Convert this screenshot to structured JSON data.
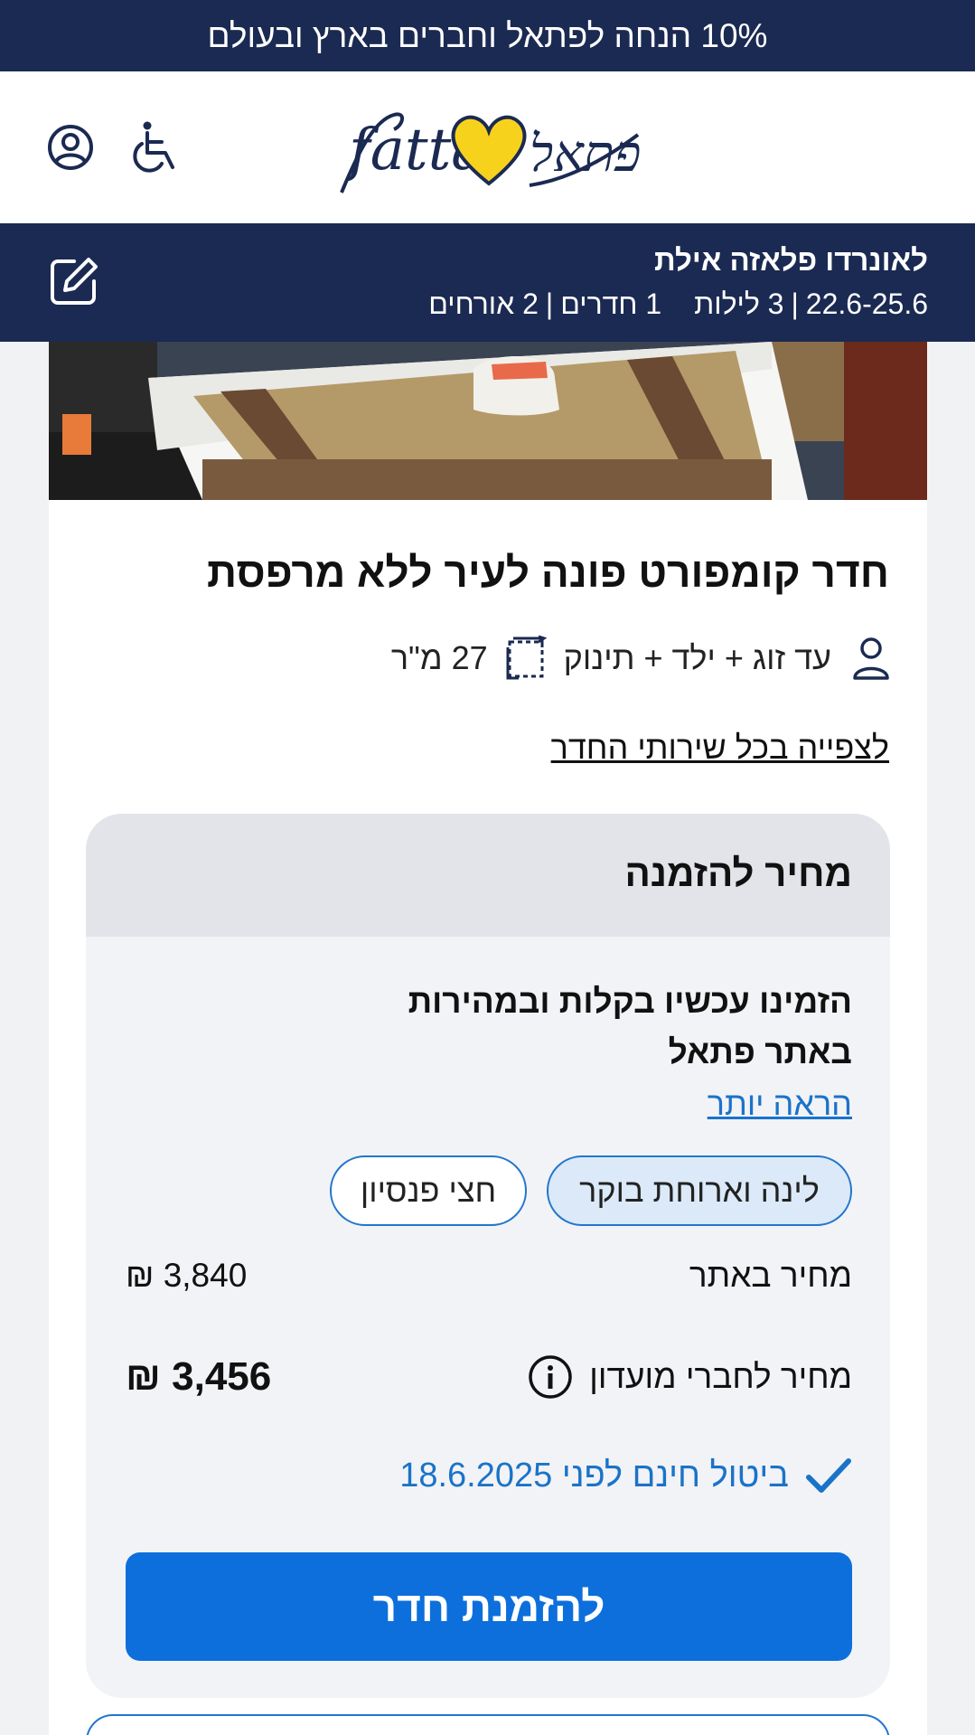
{
  "promo_bar": {
    "text": "10% הנחה לפתאל וחברים בארץ ובעולם"
  },
  "header": {
    "logo_text_latin": "fattal",
    "logo_text_hebrew": "פתאל",
    "icons": [
      "user-account-icon",
      "accessibility-icon"
    ]
  },
  "search_summary": {
    "hotel": "לאונרדו פלאזה אילת",
    "dates": "22.6-25.6",
    "nights": "3 לילות",
    "rooms": "1 חדרים",
    "guests": "2 אורחים",
    "separator": "|",
    "edit_icon": "edit-pencil-icon"
  },
  "room": {
    "title": "חדר קומפורט פונה לעיר ללא מרפסת",
    "occupancy": "עד זוג + ילד + תינוק",
    "size": "27 מ\"ר",
    "services_link": "לצפייה בכל שירותי החדר"
  },
  "price_box": {
    "heading": "מחיר להזמנה",
    "promo_line1": "הזמינו עכשיו בקלות ובמהירות",
    "promo_line2": "באתר פתאל",
    "more_link": "הראה יותר",
    "board_options": [
      {
        "label": "לינה וארוחת בוקר",
        "selected": true
      },
      {
        "label": "חצי פנסיון",
        "selected": false
      }
    ],
    "site_price_label": "מחיר באתר",
    "site_price": "3,840 ₪",
    "club_price_label": "מחיר לחברי מועדון",
    "club_price": "3,456 ₪",
    "cancellation": "ביטול חינם לפני 18.6.2025",
    "book_button": "להזמנת חדר"
  },
  "colors": {
    "navy": "#1b2a52",
    "primary_blue": "#0c6fdc",
    "link_blue": "#1a73c9",
    "logo_yellow": "#f7d21c"
  }
}
